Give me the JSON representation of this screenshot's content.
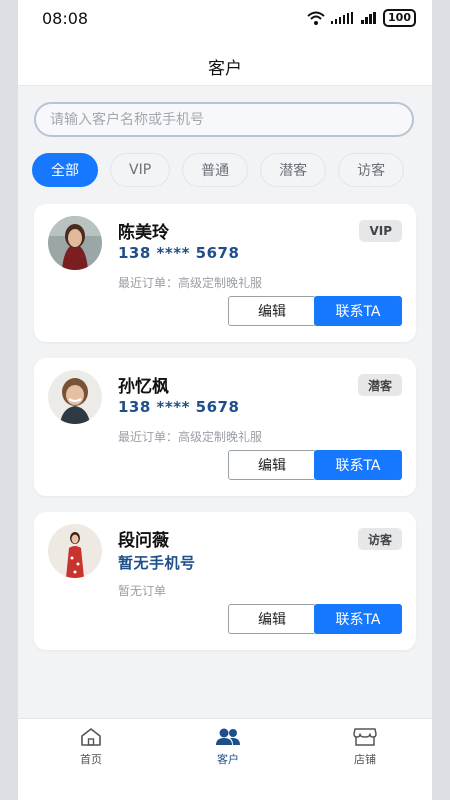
{
  "status_bar": {
    "time": "08:08",
    "battery": "100",
    "icons": [
      "wifi-icon",
      "signal-icon",
      "signal-icon",
      "battery-icon"
    ]
  },
  "header": {
    "title": "客户"
  },
  "search": {
    "placeholder": "请输入客户名称或手机号"
  },
  "filters": [
    {
      "label": "全部",
      "active": true
    },
    {
      "label": "VIP",
      "active": false
    },
    {
      "label": "普通",
      "active": false
    },
    {
      "label": "潜客",
      "active": false
    },
    {
      "label": "访客",
      "active": false
    }
  ],
  "customers": [
    {
      "name": "陈美玲",
      "phone": "138 **** 5678",
      "order": "最近订单：高级定制晚礼服",
      "badge": "VIP",
      "edit_label": "编辑",
      "contact_label": "联系TA"
    },
    {
      "name": "孙忆枫",
      "phone": "138 **** 5678",
      "order": "最近订单：高级定制晚礼服",
      "badge": "潜客",
      "edit_label": "编辑",
      "contact_label": "联系TA"
    },
    {
      "name": "段问薇",
      "phone": "暂无手机号",
      "order": "暂无订单",
      "badge": "访客",
      "edit_label": "编辑",
      "contact_label": "联系TA"
    }
  ],
  "tabbar": [
    {
      "label": "首页",
      "icon": "home-icon",
      "active": false
    },
    {
      "label": "客户",
      "icon": "users-icon",
      "active": true
    },
    {
      "label": "店铺",
      "icon": "store-icon",
      "active": false
    }
  ],
  "colors": {
    "accent": "#1677ff",
    "phone_text": "#1f4f8a",
    "background": "#f2f3f5"
  }
}
